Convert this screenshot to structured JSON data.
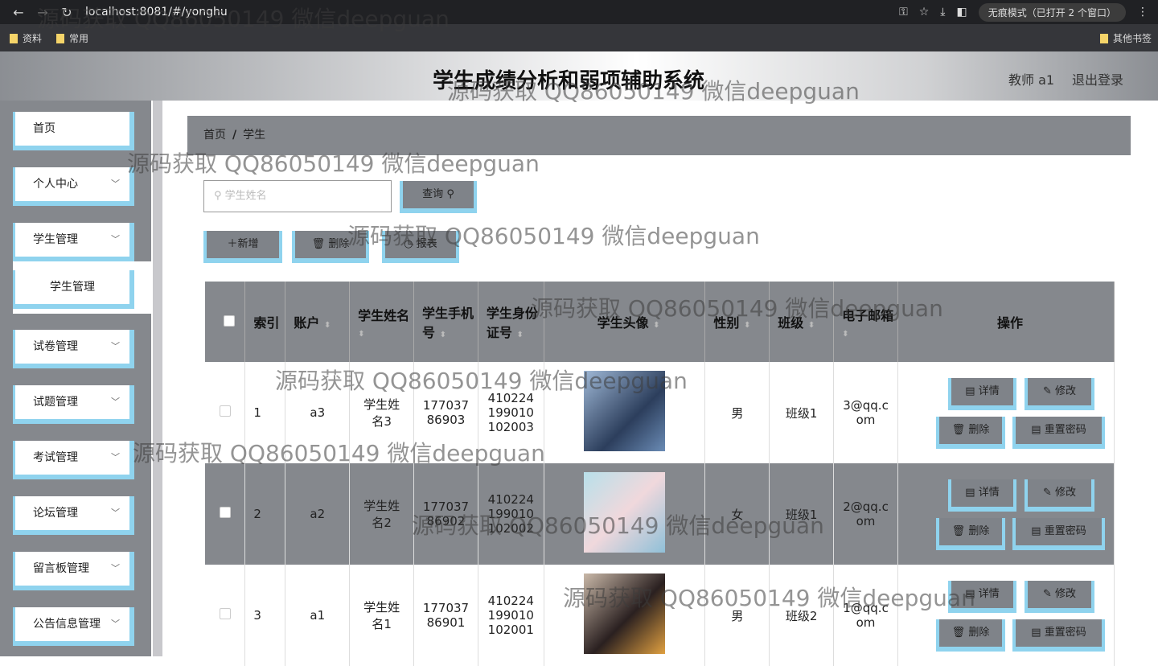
{
  "browser": {
    "url": "localhost:8081/#/yonghu",
    "incognito": "无痕模式（已打开 2 个窗口）",
    "bookmarks": [
      "资料",
      "常用"
    ],
    "other_bookmarks": "其他书签"
  },
  "header": {
    "title": "学生成绩分析和弱项辅助系统",
    "user": "教师 a1",
    "logout": "退出登录"
  },
  "sidebar": {
    "items": [
      {
        "label": "首页"
      },
      {
        "label": "个人中心"
      },
      {
        "label": "学生管理"
      },
      {
        "label": "学生管理"
      },
      {
        "label": "试卷管理"
      },
      {
        "label": "试题管理"
      },
      {
        "label": "考试管理"
      },
      {
        "label": "论坛管理"
      },
      {
        "label": "留言板管理"
      },
      {
        "label": "公告信息管理"
      }
    ]
  },
  "breadcrumb": {
    "home": "首页",
    "sep": "/",
    "current": "学生"
  },
  "search": {
    "placeholder": "学生姓名",
    "button": "查询"
  },
  "toolbar": {
    "add": "新增",
    "delete": "删除",
    "report": "报表"
  },
  "table": {
    "headers": [
      "索引",
      "账户",
      "学生姓名",
      "学生手机号",
      "学生身份证号",
      "学生头像",
      "性别",
      "班级",
      "电子邮箱",
      "操作"
    ],
    "rows": [
      {
        "index": "1",
        "account": "a3",
        "name": "学生姓名3",
        "phone": "17703786903",
        "idcard": "410224199010102003",
        "gender": "男",
        "class": "班级1",
        "email": "3@qq.com"
      },
      {
        "index": "2",
        "account": "a2",
        "name": "学生姓名2",
        "phone": "17703786902",
        "idcard": "410224199010102002",
        "gender": "女",
        "class": "班级1",
        "email": "2@qq.com"
      },
      {
        "index": "3",
        "account": "a1",
        "name": "学生姓名1",
        "phone": "17703786901",
        "idcard": "410224199010102001",
        "gender": "男",
        "class": "班级2",
        "email": "1@qq.com"
      }
    ],
    "actions": {
      "detail": "详情",
      "edit": "修改",
      "delete": "删除",
      "reset": "重置密码"
    }
  },
  "watermark": "源码获取 QQ86050149 微信deepguan",
  "colors": {
    "accent": "#8fd3ee",
    "panel": "#85888d"
  }
}
